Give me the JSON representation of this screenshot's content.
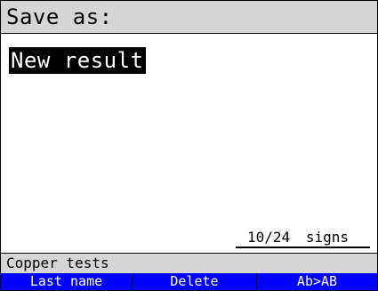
{
  "header": {
    "title": "Save as:"
  },
  "editor": {
    "value": "New result"
  },
  "counter": {
    "value": "10/24",
    "unit": "signs"
  },
  "status": {
    "text": "Copper tests"
  },
  "softkeys": [
    "Last name",
    "Delete",
    "Ab>AB"
  ],
  "colors": {
    "softkey_bg": "#0000ff",
    "bar_bg": "#d6d6d6",
    "highlight_bg": "#000000"
  }
}
